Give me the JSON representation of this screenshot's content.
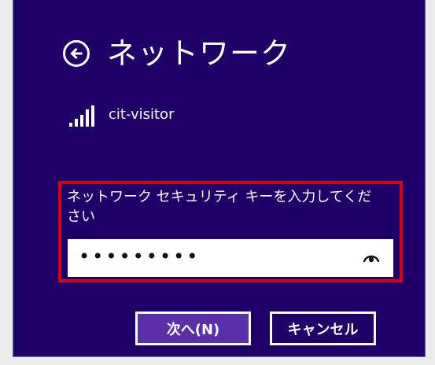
{
  "header": {
    "title": "ネットワーク",
    "back_icon": "back-arrow-icon"
  },
  "network": {
    "name": "cit-visitor",
    "signal_icon": "wifi-signal-icon"
  },
  "security": {
    "prompt": "ネットワーク セキュリティ キーを入力してください",
    "password_mask": "•••••••••",
    "reveal_icon": "eye-icon"
  },
  "buttons": {
    "next": "次へ(N)",
    "cancel": "キャンセル"
  },
  "colors": {
    "background": "#1f0068",
    "highlight_border": "#d50014",
    "primary_button": "#5b2eaa",
    "text": "#ffffff"
  }
}
